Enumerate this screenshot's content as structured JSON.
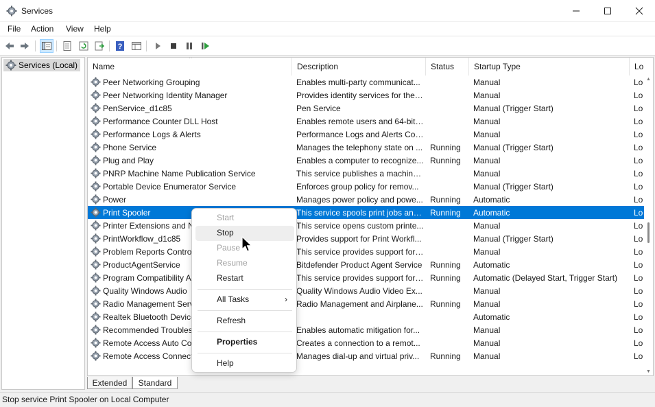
{
  "window": {
    "title": "Services"
  },
  "menu": [
    "File",
    "Action",
    "View",
    "Help"
  ],
  "tree": {
    "root_label": "Services (Local)"
  },
  "columns": {
    "name": "Name",
    "description": "Description",
    "status": "Status",
    "startup_type": "Startup Type",
    "log_on_as": "Lo"
  },
  "rows": [
    {
      "name": "Peer Networking Grouping",
      "description": "Enables multi-party communicat...",
      "status": "",
      "startup": "Manual",
      "logon": "Lo"
    },
    {
      "name": "Peer Networking Identity Manager",
      "description": "Provides identity services for the ...",
      "status": "",
      "startup": "Manual",
      "logon": "Lo"
    },
    {
      "name": "PenService_d1c85",
      "description": "Pen Service",
      "status": "",
      "startup": "Manual (Trigger Start)",
      "logon": "Lo"
    },
    {
      "name": "Performance Counter DLL Host",
      "description": "Enables remote users and 64-bit ...",
      "status": "",
      "startup": "Manual",
      "logon": "Lo"
    },
    {
      "name": "Performance Logs & Alerts",
      "description": "Performance Logs and Alerts Col...",
      "status": "",
      "startup": "Manual",
      "logon": "Lo"
    },
    {
      "name": "Phone Service",
      "description": "Manages the telephony state on ...",
      "status": "Running",
      "startup": "Manual (Trigger Start)",
      "logon": "Lo"
    },
    {
      "name": "Plug and Play",
      "description": "Enables a computer to recognize...",
      "status": "Running",
      "startup": "Manual",
      "logon": "Lo"
    },
    {
      "name": "PNRP Machine Name Publication Service",
      "description": "This service publishes a machine ...",
      "status": "",
      "startup": "Manual",
      "logon": "Lo"
    },
    {
      "name": "Portable Device Enumerator Service",
      "description": "Enforces group policy for remov...",
      "status": "",
      "startup": "Manual (Trigger Start)",
      "logon": "Lo"
    },
    {
      "name": "Power",
      "description": "Manages power policy and powe...",
      "status": "Running",
      "startup": "Automatic",
      "logon": "Lo"
    },
    {
      "name": "Print Spooler",
      "description": "This service spools print jobs and...",
      "status": "Running",
      "startup": "Automatic",
      "logon": "Lo",
      "selected": true
    },
    {
      "name": "Printer Extensions and N",
      "description": "This service opens custom printe...",
      "status": "",
      "startup": "Manual",
      "logon": "Lo"
    },
    {
      "name": "PrintWorkflow_d1c85",
      "description": "Provides support for Print Workfl...",
      "status": "",
      "startup": "Manual (Trigger Start)",
      "logon": "Lo"
    },
    {
      "name": "Problem Reports Contro",
      "description": "This service provides support for ...",
      "status": "",
      "startup": "Manual",
      "logon": "Lo"
    },
    {
      "name": "ProductAgentService",
      "description": "Bitdefender Product Agent Service",
      "status": "Running",
      "startup": "Automatic",
      "logon": "Lo"
    },
    {
      "name": "Program Compatibility A",
      "description": "This service provides support for ...",
      "status": "Running",
      "startup": "Automatic (Delayed Start, Trigger Start)",
      "logon": "Lo"
    },
    {
      "name": "Quality Windows Audio",
      "description": "Quality Windows Audio Video Ex...",
      "status": "",
      "startup": "Manual",
      "logon": "Lo"
    },
    {
      "name": "Radio Management Serv",
      "description": "Radio Management and Airplane...",
      "status": "Running",
      "startup": "Manual",
      "logon": "Lo"
    },
    {
      "name": "Realtek Bluetooth Device",
      "description": "",
      "status": "",
      "startup": "Automatic",
      "logon": "Lo"
    },
    {
      "name": "Recommended Troubles",
      "description": "Enables automatic mitigation for...",
      "status": "",
      "startup": "Manual",
      "logon": "Lo"
    },
    {
      "name": "Remote Access Auto Co",
      "description": "Creates a connection to a remot...",
      "status": "",
      "startup": "Manual",
      "logon": "Lo"
    },
    {
      "name": "Remote Access Connect",
      "description": "Manages dial-up and virtual priv...",
      "status": "Running",
      "startup": "Manual",
      "logon": "Lo"
    }
  ],
  "context_menu": {
    "start": "Start",
    "stop": "Stop",
    "pause": "Pause",
    "resume": "Resume",
    "restart": "Restart",
    "all_tasks": "All Tasks",
    "refresh": "Refresh",
    "properties": "Properties",
    "help": "Help"
  },
  "tabs": {
    "extended": "Extended",
    "standard": "Standard"
  },
  "statusbar": {
    "text": "Stop service Print Spooler on Local Computer"
  },
  "colors": {
    "selection": "#0078d7",
    "play_green": "#2e9e3f",
    "help_blue": "#3a5fbf"
  },
  "icons": [
    "gear-icon",
    "back-arrow-icon",
    "forward-arrow-icon",
    "console-tree-icon",
    "properties-icon",
    "refresh-icon",
    "export-list-icon",
    "help-icon",
    "extended-view-icon",
    "play-icon",
    "stop-icon",
    "pause-icon",
    "restart-icon"
  ]
}
